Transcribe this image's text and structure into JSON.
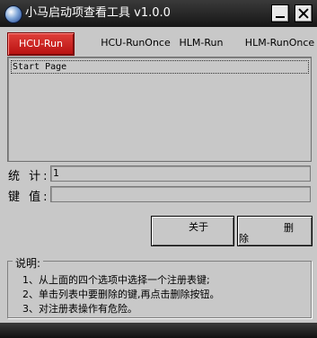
{
  "window": {
    "title": "小马启动项查看工具 v1.0.0",
    "icon": "globe-icon",
    "controls": {
      "minimize_icon": "minimize-icon",
      "close_icon": "close-icon"
    }
  },
  "tabs": [
    {
      "label": "HCU-Run",
      "active": true
    },
    {
      "label": "HCU-RunOnce",
      "active": false
    },
    {
      "label": "HLM-Run",
      "active": false
    },
    {
      "label": "HLM-RunOnce",
      "active": false
    }
  ],
  "list": {
    "items": [
      "Start Page"
    ]
  },
  "fields": {
    "count_label": "统 计:",
    "count_value": "1",
    "key_label": "键 值:",
    "key_value": ""
  },
  "buttons": {
    "about_label": "关于",
    "delete_char_1": "删",
    "delete_char_2": "除"
  },
  "note": {
    "title": "说明:",
    "lines": [
      "1、从上面的四个选项中选择一个注册表键;",
      "2、单击列表中要删除的键,再点击删除按钮。",
      "3、对注册表操作有危险。"
    ]
  },
  "colors": {
    "active_tab": "#c81a1a",
    "background": "#c8c8c8",
    "titlebar": "#222222"
  }
}
